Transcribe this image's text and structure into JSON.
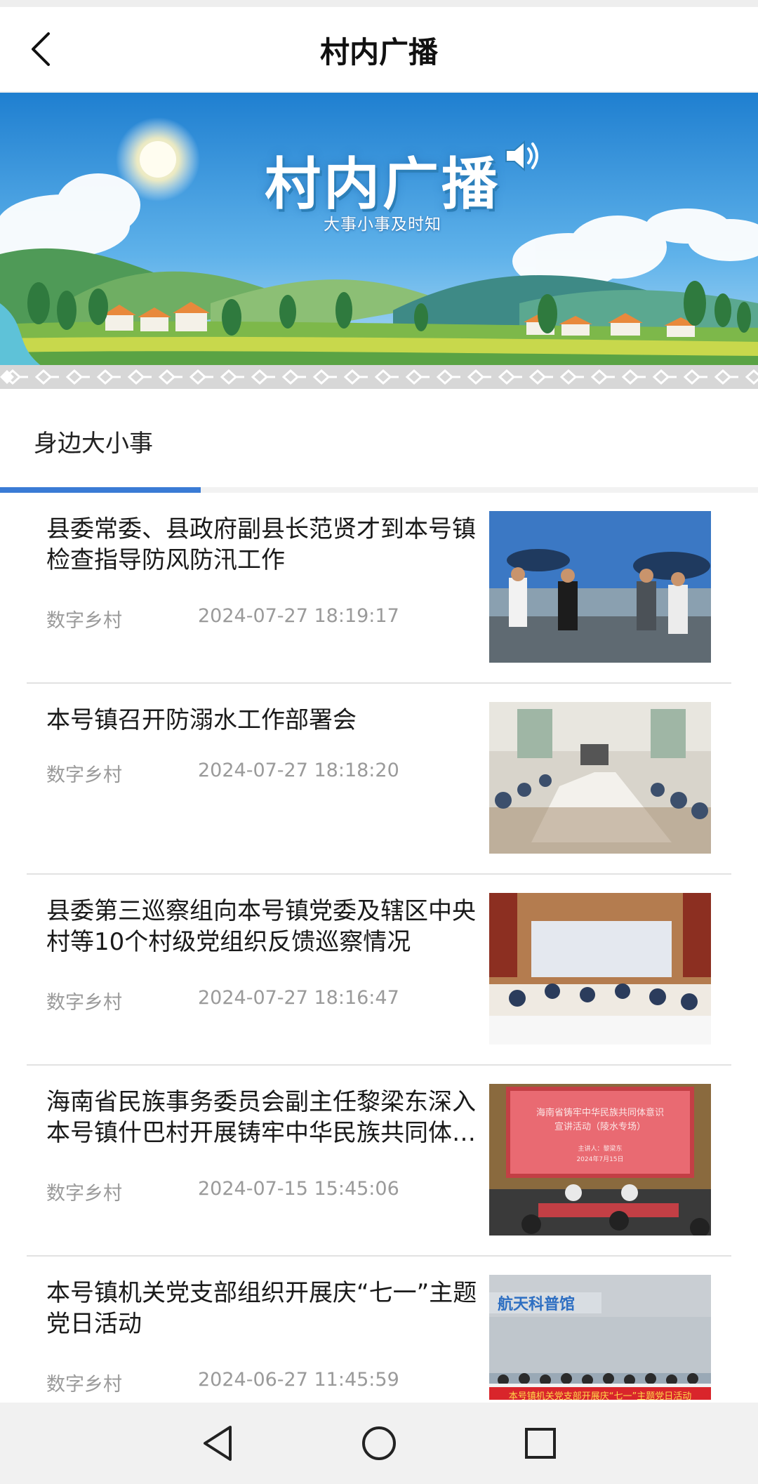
{
  "header": {
    "title": "村内广播"
  },
  "banner": {
    "title": "村内广播",
    "subtitle": "大事小事及时知"
  },
  "section": {
    "title": "身边大小事"
  },
  "news": [
    {
      "title": "县委常委、县政府副县长范贤才到本号镇检查指导防风防汛工作",
      "source": "数字乡村",
      "time": "2024-07-27 18:19:17"
    },
    {
      "title": "本号镇召开防溺水工作部署会",
      "source": "数字乡村",
      "time": "2024-07-27 18:18:20"
    },
    {
      "title": "县委第三巡察组向本号镇党委及辖区中央村等10个村级党组织反馈巡察情况",
      "source": "数字乡村",
      "time": "2024-07-27 18:16:47"
    },
    {
      "title": "海南省民族事务委员会副主任黎梁东深入本号镇什巴村开展铸牢中华民族共同体意识宣讲活动",
      "source": "数字乡村",
      "time": "2024-07-15 15:45:06"
    },
    {
      "title": "本号镇机关党支部组织开展庆“七一”主题党日活动",
      "source": "数字乡村",
      "time": "2024-06-27 11:45:59"
    }
  ],
  "thumbs": {
    "slide": {
      "line1": "海南省铸牢中华民族共同体意识",
      "line2": "宣讲活动（陵水专场）",
      "line3": "主讲人：黎梁东",
      "line4": "2024年7月15日"
    },
    "banner_red": "本号镇机关党支部开展庆“七一”主题党日活动",
    "sign": "航天科普馆"
  },
  "colors": {
    "accent": "#3a7bd5",
    "meta": "#9a9a9a"
  }
}
